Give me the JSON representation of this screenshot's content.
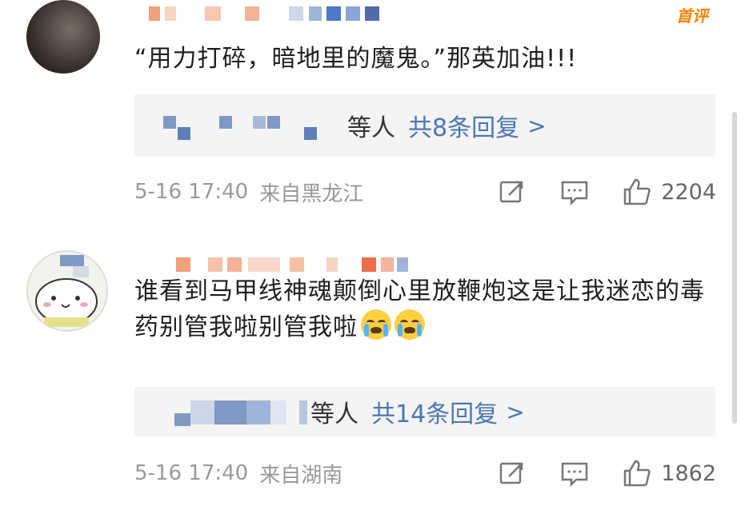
{
  "comments": [
    {
      "badge": "首评",
      "text": "“用力打碎，暗地里的魔鬼。”那英加油!!!",
      "reply_suffix": "等人",
      "reply_link": "共8条回复",
      "reply_chevron": ">",
      "time": "5-16 17:40",
      "location": "来自黑龙江",
      "likes": "2204"
    },
    {
      "text_part1": "谁看到马甲线神魂颠倒心里放鞭炮这是让我迷恋的毒药别管我啦别管我啦",
      "reply_suffix": "等人",
      "reply_link": "共14条回复",
      "reply_chevron": ">",
      "time": "5-16 17:40",
      "location": "来自湖南",
      "likes": "1862"
    }
  ],
  "colors": {
    "badge": "#ff8200",
    "link": "#4a77b5",
    "muted": "#999999"
  },
  "icons": [
    "share-icon",
    "comment-icon",
    "like-icon",
    "crying-emoji-icon"
  ]
}
